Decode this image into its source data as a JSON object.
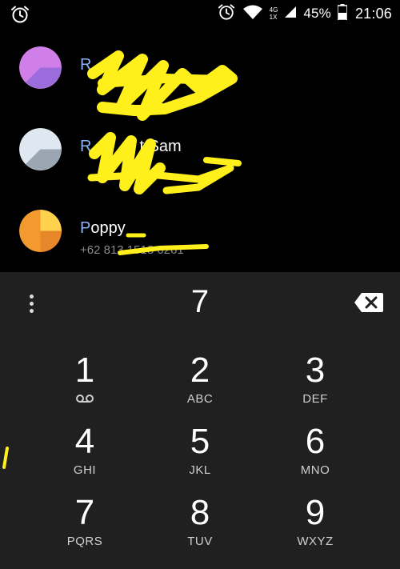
{
  "status_bar": {
    "alarm_icon_left": "alarm-clock-icon",
    "alarm_icon_right": "alarm-clock-icon",
    "network_top": "4G",
    "network_bottom": "1X",
    "battery_percent": "45%",
    "time": "21:06"
  },
  "contacts": [
    {
      "initial": "R",
      "name_visible": "",
      "number": "",
      "avatar_color_a": "#d07fe8",
      "avatar_color_b": "#9b6ddc"
    },
    {
      "initial": "R",
      "name_visible": "t.Sam",
      "number": "",
      "avatar_color_a": "#dfe8f0",
      "avatar_color_b": "#9aa6b2"
    },
    {
      "initial": "P",
      "name_visible": "oppy",
      "number": "+62 813 1518 0261",
      "avatar_color_a": "#ffd24d",
      "avatar_color_b": "#f29a2e"
    }
  ],
  "dialpad": {
    "entered_digits": "7",
    "keys": [
      {
        "digit": "1",
        "letters": ""
      },
      {
        "digit": "2",
        "letters": "ABC"
      },
      {
        "digit": "3",
        "letters": "DEF"
      },
      {
        "digit": "4",
        "letters": "GHI"
      },
      {
        "digit": "5",
        "letters": "JKL"
      },
      {
        "digit": "6",
        "letters": "MNO"
      },
      {
        "digit": "7",
        "letters": "PQRS"
      },
      {
        "digit": "8",
        "letters": "TUV"
      },
      {
        "digit": "9",
        "letters": "WXYZ"
      }
    ]
  },
  "colors": {
    "dialpad_bg": "#202020",
    "list_bg": "#000000",
    "highlight_initial": "#8ab4f8",
    "redaction": "#ffef1a"
  }
}
